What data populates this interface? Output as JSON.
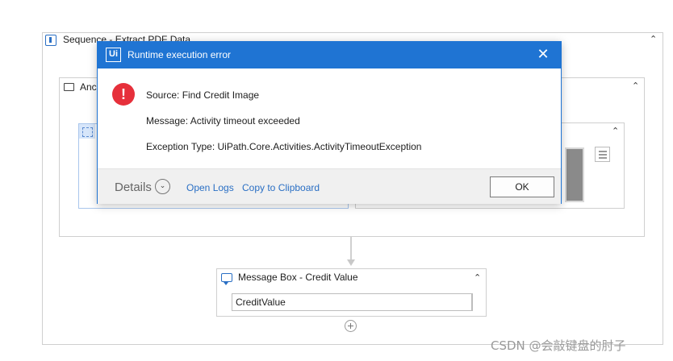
{
  "sequence": {
    "title": "Sequence - Extract PDF Data",
    "collapse_glyph": "⌃"
  },
  "anchor": {
    "title": "Anc",
    "collapse_glyph": "⌃"
  },
  "inner_right": {
    "collapse_glyph": "⌃"
  },
  "message_box": {
    "title": "Message Box - Credit Value",
    "collapse_glyph": "⌃",
    "input_value": "CreditValue"
  },
  "dialog": {
    "app_icon_text": "Ui",
    "title": "Runtime execution error",
    "close_glyph": "✕",
    "error_glyph": "!",
    "source": "Source: Find Credit Image",
    "message": "Message: Activity timeout exceeded",
    "exception": "Exception Type: UiPath.Core.Activities.ActivityTimeoutException",
    "details_label": "Details",
    "details_glyph": "⌄",
    "open_logs": "Open Logs",
    "copy_clipboard": "Copy to Clipboard",
    "ok": "OK"
  },
  "watermark": "CSDN @会敲键盘的肘子",
  "colors": {
    "accent": "#1f74d3",
    "error": "#e6303b",
    "link": "#2a6fc4"
  },
  "icons": [
    "sequence-icon",
    "anchor-icon",
    "message-box-icon",
    "add-activity-icon",
    "uipath-app-icon",
    "close-icon",
    "error-icon",
    "chevron-down-icon",
    "collapse-icon",
    "menu-lines-icon"
  ]
}
